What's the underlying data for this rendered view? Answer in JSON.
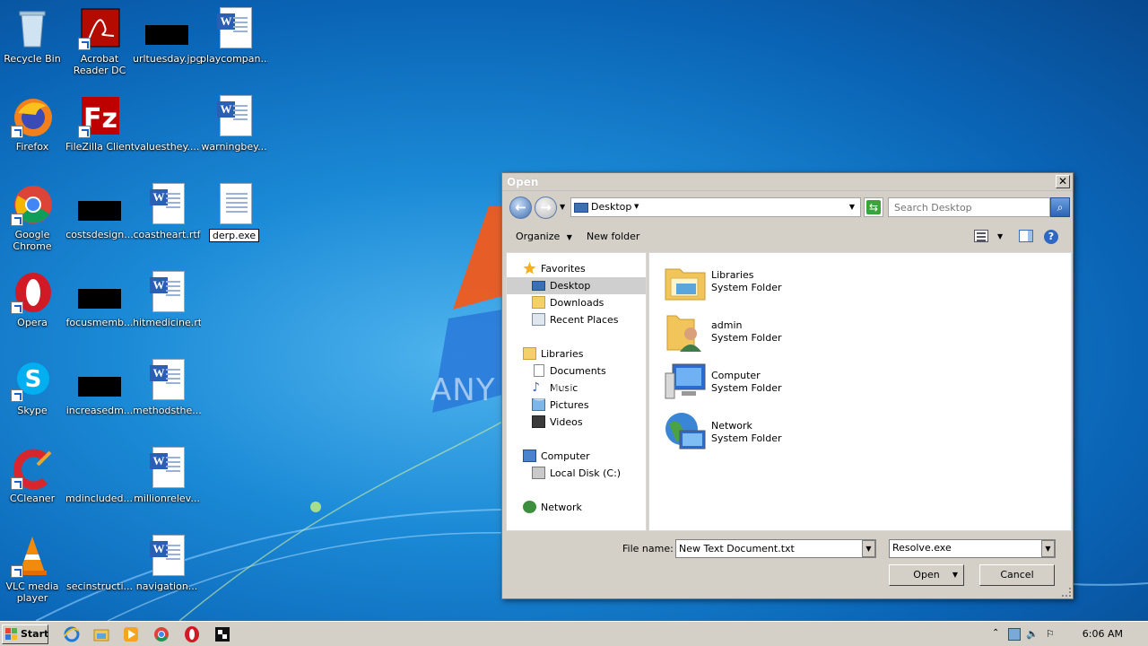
{
  "desktop": {
    "icons": [
      {
        "name": "recycle-bin",
        "label": "Recycle Bin"
      },
      {
        "name": "acrobat-reader",
        "label": "Acrobat Reader DC"
      },
      {
        "name": "urltuesday-jpg",
        "label": "urltuesday.jpg"
      },
      {
        "name": "playcompan-doc",
        "label": "playcompan..."
      },
      {
        "name": "firefox",
        "label": "Firefox"
      },
      {
        "name": "filezilla",
        "label": "FileZilla Client"
      },
      {
        "name": "valuesthey",
        "label": "valuesthey...."
      },
      {
        "name": "warningbey",
        "label": "warningbey..."
      },
      {
        "name": "google-chrome",
        "label": "Google Chrome"
      },
      {
        "name": "costsdesign",
        "label": "costsdesign..."
      },
      {
        "name": "coastheart-rtf",
        "label": "coastheart.rtf"
      },
      {
        "name": "derp-exe",
        "label": "derp.exe"
      },
      {
        "name": "opera",
        "label": "Opera"
      },
      {
        "name": "focusmemb",
        "label": "focusmemb..."
      },
      {
        "name": "hitmedicine-rtf",
        "label": "hitmedicine.rtf"
      },
      {
        "name": "skype",
        "label": "Skype"
      },
      {
        "name": "increasedm",
        "label": "increasedm..."
      },
      {
        "name": "methodsthe",
        "label": "methodsthe..."
      },
      {
        "name": "ccleaner",
        "label": "CCleaner"
      },
      {
        "name": "mdincluded",
        "label": "mdincluded...."
      },
      {
        "name": "millionrelev",
        "label": "millionrelev..."
      },
      {
        "name": "vlc-player",
        "label": "VLC media player"
      },
      {
        "name": "secinstructi",
        "label": "secinstructi..."
      },
      {
        "name": "navigation",
        "label": "navigation..."
      }
    ]
  },
  "dialog": {
    "title": "Open",
    "address": "Desktop",
    "search_placeholder": "Search Desktop",
    "toolbar": {
      "organize": "Organize",
      "new_folder": "New folder"
    },
    "nav": {
      "favorites": "Favorites",
      "desktop": "Desktop",
      "downloads": "Downloads",
      "recent_places": "Recent Places",
      "libraries": "Libraries",
      "documents": "Documents",
      "music": "Music",
      "pictures": "Pictures",
      "videos": "Videos",
      "computer": "Computer",
      "local_disk": "Local Disk (C:)",
      "network": "Network"
    },
    "files": [
      {
        "name": "Libraries",
        "type": "System Folder"
      },
      {
        "name": "admin",
        "type": "System Folder"
      },
      {
        "name": "Computer",
        "type": "System Folder"
      },
      {
        "name": "Network",
        "type": "System Folder"
      }
    ],
    "file_name_label": "File name:",
    "file_name_value": "New Text Document.txt",
    "filter_value": "Resolve.exe",
    "open_button": "Open",
    "cancel_button": "Cancel"
  },
  "watermark": "ANY RUN",
  "taskbar": {
    "start_label": "Start",
    "clock": "6:06 AM"
  },
  "colors": {
    "desktop_blue": "#1b8ad6",
    "dialog_gray": "#d4d0c8",
    "selection_gray": "#cfcfcf"
  }
}
